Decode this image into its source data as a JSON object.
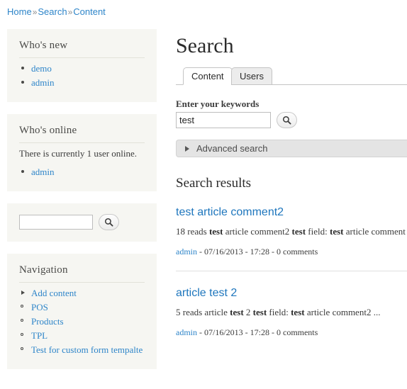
{
  "breadcrumb": {
    "separator": "»",
    "items": [
      {
        "label": "Home"
      },
      {
        "label": "Search"
      },
      {
        "label": "Content"
      }
    ]
  },
  "sidebar": {
    "blocks": [
      {
        "id": "whos-new",
        "title": "Who's new",
        "items": [
          {
            "label": "demo",
            "bullet": "disc"
          },
          {
            "label": "admin",
            "bullet": "disc"
          }
        ]
      },
      {
        "id": "whos-online",
        "title": "Who's online",
        "text": "There is currently 1 user online.",
        "items": [
          {
            "label": "admin",
            "bullet": "disc"
          }
        ]
      },
      {
        "id": "search",
        "input_value": "",
        "input_placeholder": "",
        "button_icon": "search-icon"
      },
      {
        "id": "navigation",
        "title": "Navigation",
        "items": [
          {
            "label": "Add content",
            "bullet": "arrow"
          },
          {
            "label": "POS",
            "bullet": "circle"
          },
          {
            "label": "Products",
            "bullet": "circle"
          },
          {
            "label": "TPL",
            "bullet": "circle"
          },
          {
            "label": "Test for custom form tempalte",
            "bullet": "circle"
          }
        ]
      }
    ]
  },
  "main": {
    "title": "Search",
    "tabs": [
      {
        "id": "content",
        "label": "Content",
        "active": true
      },
      {
        "id": "users",
        "label": "Users",
        "active": false
      }
    ],
    "keyword_label": "Enter your keywords",
    "keyword_value": "test",
    "keyword_placeholder": "",
    "search_button_icon": "search-icon",
    "advanced_search": {
      "label": "Advanced search",
      "icon": "triangle-right-icon",
      "expanded": false
    },
    "results_title": "Search results",
    "results": [
      {
        "title": "test article comment2",
        "snippet_parts": [
          {
            "text": "18 reads ",
            "bold": false
          },
          {
            "text": "test",
            "bold": true
          },
          {
            "text": " article comment2 ",
            "bold": false
          },
          {
            "text": "test",
            "bold": true
          },
          {
            "text": " field:  ",
            "bold": false
          },
          {
            "text": "test",
            "bold": true
          },
          {
            "text": " article comment",
            "bold": false
          }
        ],
        "author": "admin",
        "meta_rest": " - 07/16/2013 - 17:28 - 0 comments"
      },
      {
        "title": "article test 2",
        "snippet_parts": [
          {
            "text": "5 reads article ",
            "bold": false
          },
          {
            "text": "test",
            "bold": true
          },
          {
            "text": " 2 ",
            "bold": false
          },
          {
            "text": "test",
            "bold": true
          },
          {
            "text": " field:  ",
            "bold": false
          },
          {
            "text": "test",
            "bold": true
          },
          {
            "text": " article comment2 ...",
            "bold": false
          }
        ],
        "author": "admin",
        "meta_rest": " - 07/16/2013 - 17:28 - 0 comments"
      }
    ]
  },
  "colors": {
    "link": "#2e85c9",
    "result_link": "#1e76bd",
    "block_bg": "#f6f6f2",
    "advanced_bg": "#e4e4e4",
    "text": "#3b3b3b"
  }
}
